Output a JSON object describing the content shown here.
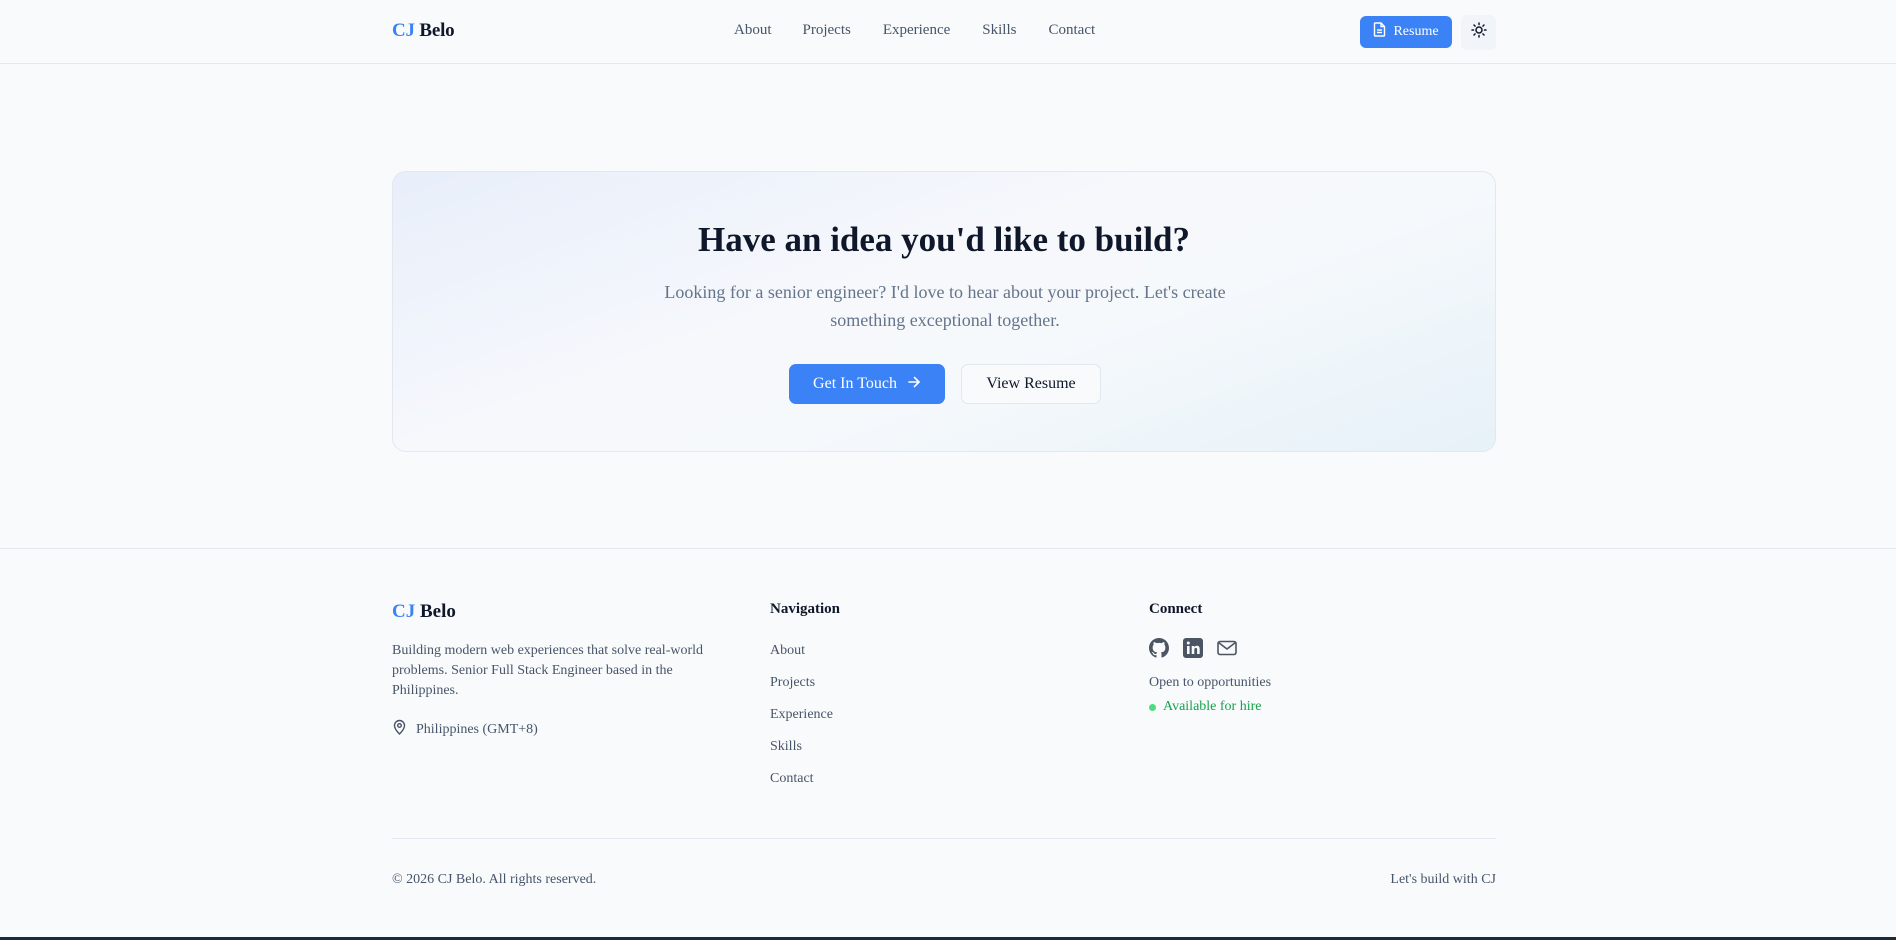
{
  "header": {
    "logo_accent": "CJ",
    "logo_rest": "Belo",
    "nav": [
      "About",
      "Projects",
      "Experience",
      "Skills",
      "Contact"
    ],
    "resume_label": "Resume",
    "resume_icon": "document-icon",
    "theme_icon": "sun-icon"
  },
  "cta": {
    "title": "Have an idea you'd like to build?",
    "subtitle": "Looking for a senior engineer? I'd love to hear about your project. Let's create something exceptional together.",
    "primary_label": "Get In Touch",
    "primary_icon": "arrow-right-icon",
    "secondary_label": "View Resume"
  },
  "footer": {
    "logo_accent": "CJ",
    "logo_rest": "Belo",
    "description": "Building modern web experiences that solve real-world problems. Senior Full Stack Engineer based in the Philippines.",
    "location": "Philippines (GMT+8)",
    "location_icon": "map-pin-icon",
    "nav_heading": "Navigation",
    "nav": [
      "About",
      "Projects",
      "Experience",
      "Skills",
      "Contact"
    ],
    "connect_heading": "Connect",
    "socials": [
      "github-icon",
      "linkedin-icon",
      "mail-icon"
    ],
    "open_text": "Open to opportunities",
    "availability": "Available for hire",
    "copyright": "© 2026 CJ Belo. All rights reserved.",
    "tagline": "Let's build with CJ"
  },
  "colors": {
    "accent": "#3b82f6",
    "available": "#16a34a",
    "background": "#f8fafc"
  }
}
